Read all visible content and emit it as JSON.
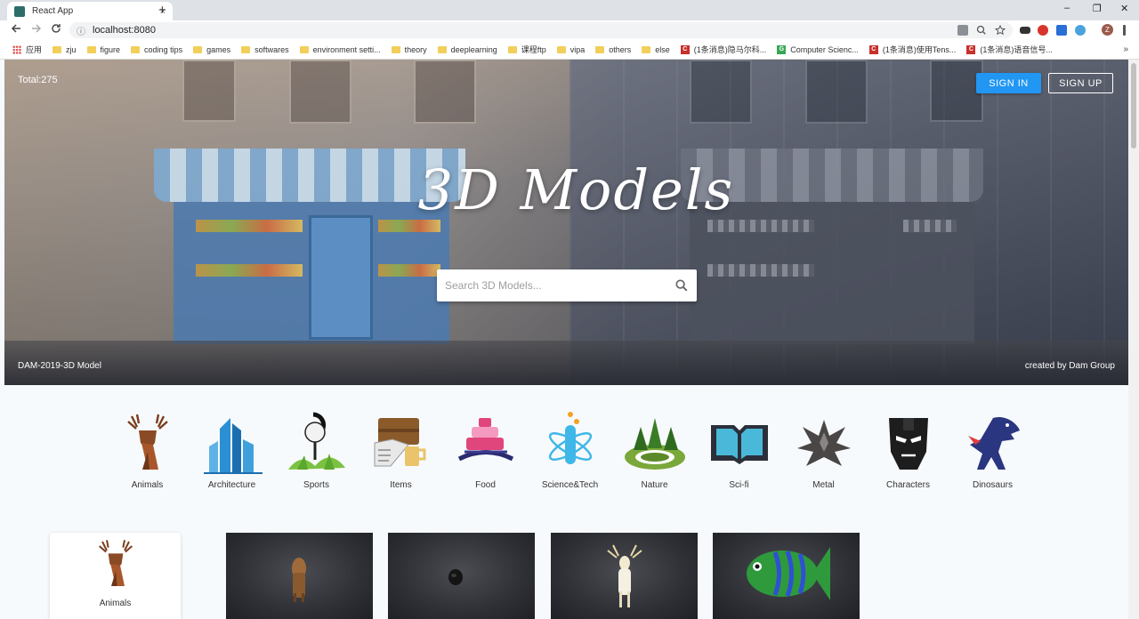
{
  "browser": {
    "tab_title": "React App",
    "tab_close": "×",
    "new_tab": "+",
    "window_controls": [
      "–",
      "❐",
      "✕"
    ],
    "url": "localhost:8080",
    "profile_initial": "Z",
    "bookmarks": [
      {
        "type": "apps",
        "label": "应用"
      },
      {
        "type": "folder",
        "label": "zju"
      },
      {
        "type": "folder",
        "label": "figure"
      },
      {
        "type": "folder",
        "label": "coding tips"
      },
      {
        "type": "folder",
        "label": "games"
      },
      {
        "type": "folder",
        "label": "softwares"
      },
      {
        "type": "folder",
        "label": "environment setti..."
      },
      {
        "type": "folder",
        "label": "theory"
      },
      {
        "type": "folder",
        "label": "deeplearning"
      },
      {
        "type": "folder",
        "label": "课程ftp"
      },
      {
        "type": "folder",
        "label": "vipa"
      },
      {
        "type": "folder",
        "label": "others"
      },
      {
        "type": "folder",
        "label": "else"
      },
      {
        "type": "csdn",
        "label": "(1条消息)隐马尔科..."
      },
      {
        "type": "green",
        "label": "Computer Scienc..."
      },
      {
        "type": "csdn",
        "label": "(1条消息)使用Tens..."
      },
      {
        "type": "csdn",
        "label": "(1条消息)语音信号..."
      }
    ],
    "bookmarks_more": "»"
  },
  "hero": {
    "total": "Total:275",
    "title": "3D Models",
    "sign_in": "SIGN IN",
    "sign_up": "SIGN UP",
    "search_placeholder": "Search 3D Models...",
    "footer_left": "DAM-2019-3D Model",
    "footer_right": "created by Dam Group"
  },
  "categories": [
    {
      "label": "Animals",
      "icon": "deer-icon"
    },
    {
      "label": "Architecture",
      "icon": "buildings-icon"
    },
    {
      "label": "Sports",
      "icon": "golf-ball-icon"
    },
    {
      "label": "Items",
      "icon": "briefcase-newspaper-mug-icon"
    },
    {
      "label": "Food",
      "icon": "cake-icon"
    },
    {
      "label": "Science&Tech",
      "icon": "test-tube-atom-icon"
    },
    {
      "label": "Nature",
      "icon": "forest-icon"
    },
    {
      "label": "Sci-fi",
      "icon": "book-icon"
    },
    {
      "label": "Metal",
      "icon": "metal-emblem-icon"
    },
    {
      "label": "Characters",
      "icon": "iron-man-mask-icon"
    },
    {
      "label": "Dinosaurs",
      "icon": "dinosaur-icon"
    }
  ],
  "selected_category": {
    "label": "Animals",
    "icon": "deer-icon"
  },
  "models": [
    {
      "name": "dog-model",
      "thumb": "dog-thumbnail"
    },
    {
      "name": "dark-animal-model",
      "thumb": "dark-creature-thumbnail"
    },
    {
      "name": "deer-model",
      "thumb": "white-deer-thumbnail"
    },
    {
      "name": "fish-model",
      "thumb": "green-fish-thumbnail"
    }
  ],
  "colors": {
    "primary": "#2196f3",
    "page_bg": "#f7fafc",
    "card_bg": "#2e3036"
  }
}
